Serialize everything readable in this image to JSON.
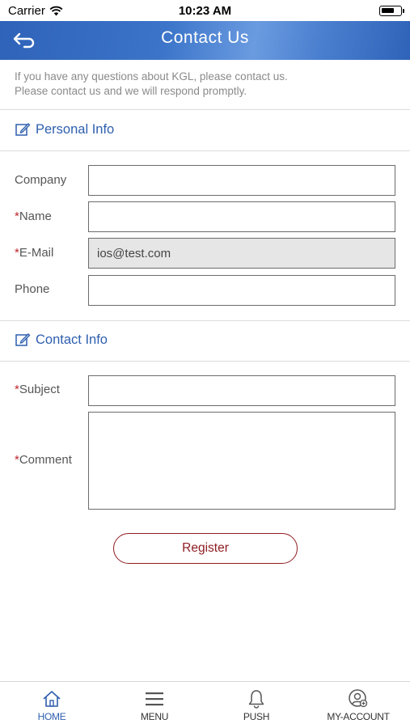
{
  "status_bar": {
    "carrier": "Carrier",
    "time": "10:23 AM",
    "battery_level": 0.7
  },
  "header": {
    "title": "Contact Us",
    "back_icon": "back-arrow-icon"
  },
  "intro": {
    "line1": "If you have any questions about KGL, please contact us.",
    "line2": "Please contact us and we will respond promptly."
  },
  "sections": {
    "personal": {
      "label": "Personal Info",
      "icon": "edit-icon"
    },
    "contact": {
      "label": "Contact Info",
      "icon": "edit-icon"
    }
  },
  "fields": {
    "company": {
      "label": "Company",
      "required": false,
      "value": ""
    },
    "name": {
      "label": "Name",
      "required": true,
      "value": ""
    },
    "email": {
      "label": "E-Mail",
      "required": true,
      "value": "ios@test.com"
    },
    "phone": {
      "label": "Phone",
      "required": false,
      "value": ""
    },
    "subject": {
      "label": "Subject",
      "required": true,
      "value": ""
    },
    "comment": {
      "label": "Comment",
      "required": true,
      "value": ""
    }
  },
  "required_marker": "*",
  "register_label": "Register",
  "nav": [
    {
      "label": "HOME",
      "icon": "home-icon",
      "active": true
    },
    {
      "label": "MENU",
      "icon": "menu-icon",
      "active": false
    },
    {
      "label": "PUSH",
      "icon": "bell-icon",
      "active": false
    },
    {
      "label": "MY-ACCOUNT",
      "icon": "account-icon",
      "active": false
    }
  ],
  "colors": {
    "header_blue": "#2f63b9",
    "accent_blue": "#2e5fae",
    "required_red": "#c0262d",
    "register_red": "#8f1d22"
  }
}
